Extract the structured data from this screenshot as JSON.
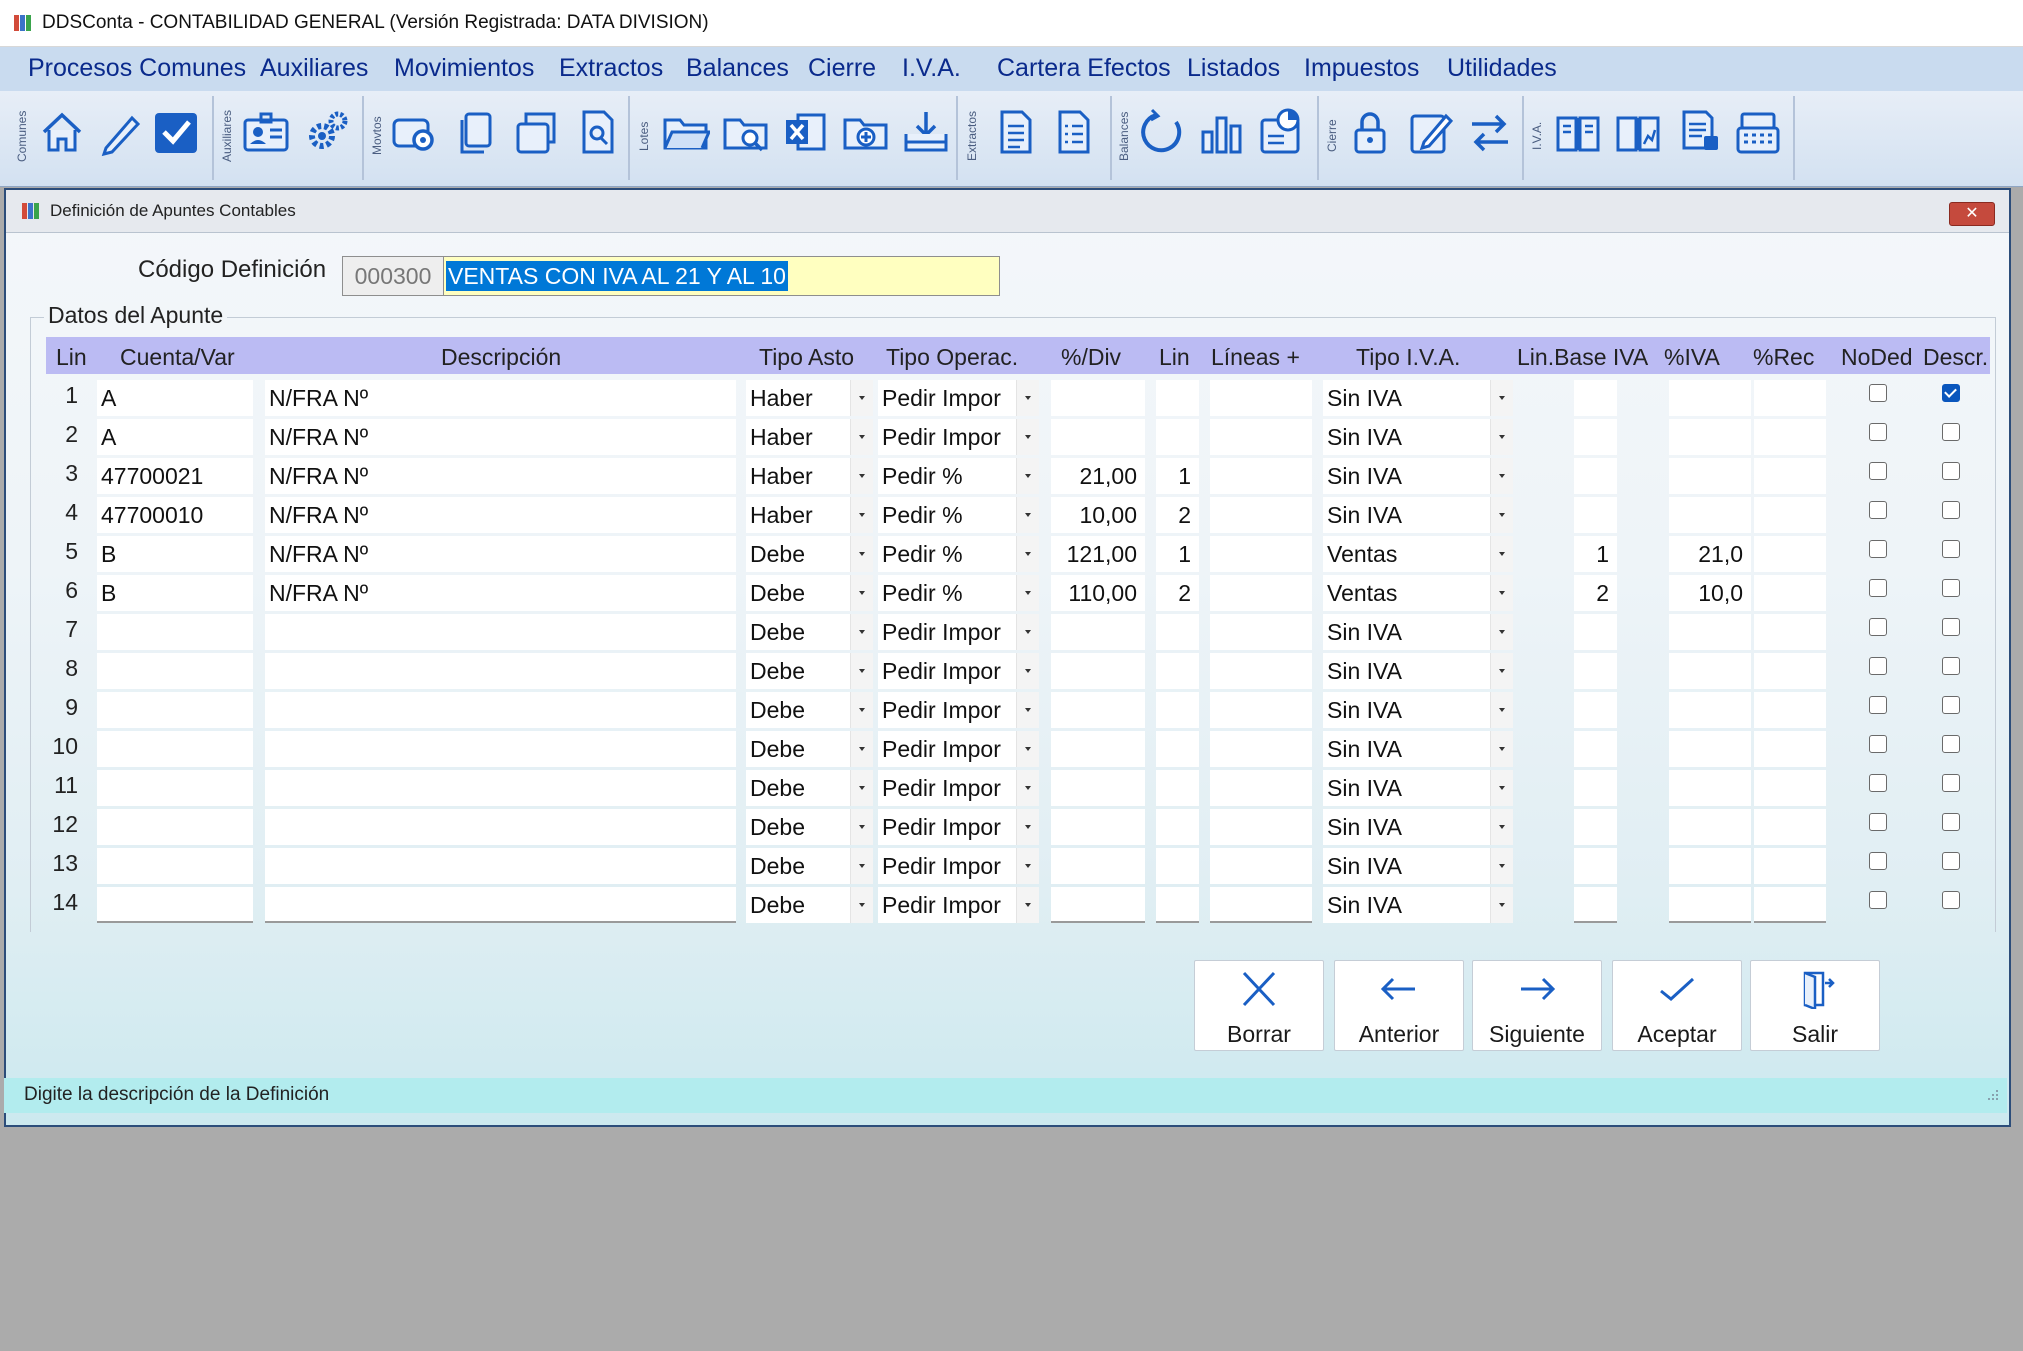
{
  "app": {
    "title": "DDSConta - CONTABILIDAD GENERAL (Versión Registrada: DATA DIVISION)"
  },
  "menu": [
    "Procesos Comunes",
    "Auxiliares",
    "Movimientos",
    "Extractos",
    "Balances",
    "Cierre",
    "I.V.A.",
    "Cartera Efectos",
    "Listados",
    "Impuestos",
    "Utilidades"
  ],
  "toolbar": {
    "groups": [
      "Comunes",
      "Auxiliares",
      "Movtos",
      "Lotes",
      "Extractos",
      "Balances",
      "Cierre",
      "I.V.A."
    ],
    "icons": [
      "home-icon",
      "edit-icon",
      "check-icon",
      "contact-card-icon",
      "settings-icon",
      "disk-search-icon",
      "copy-icon",
      "duplicate-icon",
      "document-search-icon",
      "folder-open-icon",
      "folder-search-icon",
      "excel-icon",
      "folder-add-icon",
      "download-icon",
      "document-lines-icon",
      "document-list-icon",
      "refresh-icon",
      "bar-chart-icon",
      "report-chart-icon",
      "lock-icon",
      "edit-document-icon",
      "transfer-icon",
      "book-icon",
      "book-chart-icon",
      "printer-document-icon",
      "cash-register-icon"
    ]
  },
  "window": {
    "title": "Definición de Apuntes Contables",
    "close": "✕"
  },
  "form": {
    "codigo_label": "Código Definición",
    "codigo_value": "000300",
    "descripcion_value": "VENTAS CON IVA AL 21 Y AL 10",
    "fieldset_label": "Datos del Apunte"
  },
  "table": {
    "columns": [
      "Lin",
      "Cuenta/Var",
      "Descripción",
      "Tipo Asto",
      "Tipo Operac.",
      "%/Div",
      "Lin",
      "Líneas +",
      "Tipo I.V.A.",
      "Lin.Base IVA",
      "%IVA",
      "%Rec",
      "NoDed",
      "Descr."
    ],
    "rows": [
      {
        "lin": "1",
        "cuenta": "A",
        "descripcion": "N/FRA Nº",
        "tipo_asto": "Haber",
        "tipo_operac": "Pedir Impor",
        "pct_div": "",
        "lin2": "",
        "lineas": "",
        "tipo_iva": "Sin IVA",
        "lin_base": "",
        "pct_iva": "",
        "pct_rec": "",
        "noded": false,
        "descr": true
      },
      {
        "lin": "2",
        "cuenta": "A",
        "descripcion": "N/FRA Nº",
        "tipo_asto": "Haber",
        "tipo_operac": "Pedir Impor",
        "pct_div": "",
        "lin2": "",
        "lineas": "",
        "tipo_iva": "Sin IVA",
        "lin_base": "",
        "pct_iva": "",
        "pct_rec": "",
        "noded": false,
        "descr": false
      },
      {
        "lin": "3",
        "cuenta": "47700021",
        "descripcion": "N/FRA Nº",
        "tipo_asto": "Haber",
        "tipo_operac": "Pedir %",
        "pct_div": "21,00",
        "lin2": "1",
        "lineas": "",
        "tipo_iva": "Sin IVA",
        "lin_base": "",
        "pct_iva": "",
        "pct_rec": "",
        "noded": false,
        "descr": false
      },
      {
        "lin": "4",
        "cuenta": "47700010",
        "descripcion": "N/FRA Nº",
        "tipo_asto": "Haber",
        "tipo_operac": "Pedir %",
        "pct_div": "10,00",
        "lin2": "2",
        "lineas": "",
        "tipo_iva": "Sin IVA",
        "lin_base": "",
        "pct_iva": "",
        "pct_rec": "",
        "noded": false,
        "descr": false
      },
      {
        "lin": "5",
        "cuenta": "B",
        "descripcion": "N/FRA Nº",
        "tipo_asto": "Debe",
        "tipo_operac": "Pedir %",
        "pct_div": "121,00",
        "lin2": "1",
        "lineas": "",
        "tipo_iva": "Ventas",
        "lin_base": "1",
        "pct_iva": "21,0",
        "pct_rec": "",
        "noded": false,
        "descr": false
      },
      {
        "lin": "6",
        "cuenta": "B",
        "descripcion": "N/FRA Nº",
        "tipo_asto": "Debe",
        "tipo_operac": "Pedir %",
        "pct_div": "110,00",
        "lin2": "2",
        "lineas": "",
        "tipo_iva": "Ventas",
        "lin_base": "2",
        "pct_iva": "10,0",
        "pct_rec": "",
        "noded": false,
        "descr": false
      },
      {
        "lin": "7",
        "cuenta": "",
        "descripcion": "",
        "tipo_asto": "Debe",
        "tipo_operac": "Pedir Impor",
        "pct_div": "",
        "lin2": "",
        "lineas": "",
        "tipo_iva": "Sin IVA",
        "lin_base": "",
        "pct_iva": "",
        "pct_rec": "",
        "noded": false,
        "descr": false
      },
      {
        "lin": "8",
        "cuenta": "",
        "descripcion": "",
        "tipo_asto": "Debe",
        "tipo_operac": "Pedir Impor",
        "pct_div": "",
        "lin2": "",
        "lineas": "",
        "tipo_iva": "Sin IVA",
        "lin_base": "",
        "pct_iva": "",
        "pct_rec": "",
        "noded": false,
        "descr": false
      },
      {
        "lin": "9",
        "cuenta": "",
        "descripcion": "",
        "tipo_asto": "Debe",
        "tipo_operac": "Pedir Impor",
        "pct_div": "",
        "lin2": "",
        "lineas": "",
        "tipo_iva": "Sin IVA",
        "lin_base": "",
        "pct_iva": "",
        "pct_rec": "",
        "noded": false,
        "descr": false
      },
      {
        "lin": "10",
        "cuenta": "",
        "descripcion": "",
        "tipo_asto": "Debe",
        "tipo_operac": "Pedir Impor",
        "pct_div": "",
        "lin2": "",
        "lineas": "",
        "tipo_iva": "Sin IVA",
        "lin_base": "",
        "pct_iva": "",
        "pct_rec": "",
        "noded": false,
        "descr": false
      },
      {
        "lin": "11",
        "cuenta": "",
        "descripcion": "",
        "tipo_asto": "Debe",
        "tipo_operac": "Pedir Impor",
        "pct_div": "",
        "lin2": "",
        "lineas": "",
        "tipo_iva": "Sin IVA",
        "lin_base": "",
        "pct_iva": "",
        "pct_rec": "",
        "noded": false,
        "descr": false
      },
      {
        "lin": "12",
        "cuenta": "",
        "descripcion": "",
        "tipo_asto": "Debe",
        "tipo_operac": "Pedir Impor",
        "pct_div": "",
        "lin2": "",
        "lineas": "",
        "tipo_iva": "Sin IVA",
        "lin_base": "",
        "pct_iva": "",
        "pct_rec": "",
        "noded": false,
        "descr": false
      },
      {
        "lin": "13",
        "cuenta": "",
        "descripcion": "",
        "tipo_asto": "Debe",
        "tipo_operac": "Pedir Impor",
        "pct_div": "",
        "lin2": "",
        "lineas": "",
        "tipo_iva": "Sin IVA",
        "lin_base": "",
        "pct_iva": "",
        "pct_rec": "",
        "noded": false,
        "descr": false
      },
      {
        "lin": "14",
        "cuenta": "",
        "descripcion": "",
        "tipo_asto": "Debe",
        "tipo_operac": "Pedir Impor",
        "pct_div": "",
        "lin2": "",
        "lineas": "",
        "tipo_iva": "Sin IVA",
        "lin_base": "",
        "pct_iva": "",
        "pct_rec": "",
        "noded": false,
        "descr": false
      }
    ]
  },
  "buttons": {
    "borrar": "Borrar",
    "anterior": "Anterior",
    "siguiente": "Siguiente",
    "aceptar": "Aceptar",
    "salir": "Salir"
  },
  "status": {
    "text": "Digite la descripción de la Definición"
  },
  "colors": {
    "accent": "#0a2a8c",
    "selection": "#0078d7",
    "header": "#bbbbf3",
    "status": "#b2ecee",
    "icon_blue": "#1a5fc4"
  }
}
